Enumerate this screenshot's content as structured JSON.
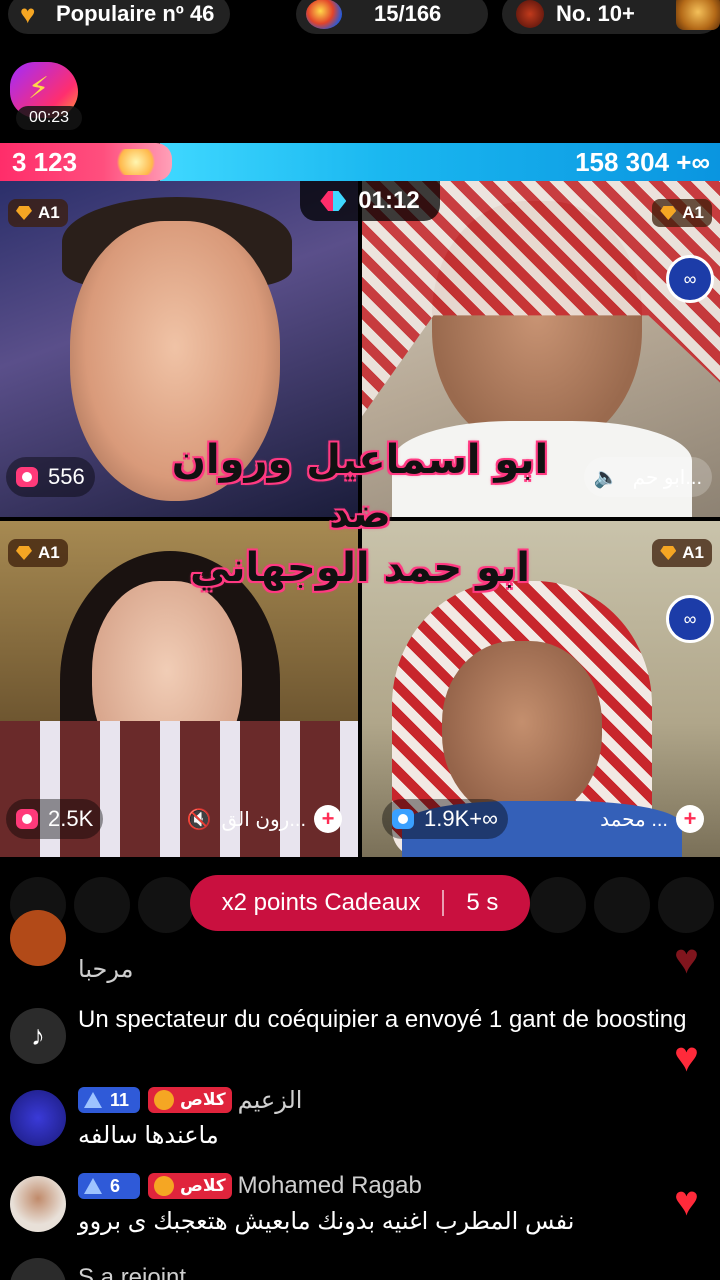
{
  "top_stats": {
    "popular": "Populaire nº 46",
    "progress": "15/166",
    "rank": "No. 10+"
  },
  "mini_badge": {
    "time": "00:23"
  },
  "score": {
    "left": "3 123",
    "right": "158 304",
    "left_fraction": 0.02
  },
  "battle": {
    "timer": "01:12",
    "overlay_title": [
      "ابو اسماعيل وروان",
      "ضد",
      "ابو حمد الوجهاني"
    ],
    "tiles": [
      {
        "tier": "A1",
        "stat": "556"
      },
      {
        "tier": "A1",
        "name": "ابو حم..."
      },
      {
        "tier": "A1",
        "stat": "2.5K",
        "name": "رون الق..."
      },
      {
        "tier": "A1",
        "stat": "1.9K+",
        "name": "محمد ..."
      }
    ]
  },
  "boost": {
    "label": "x2 points Cadeaux",
    "countdown": "5 s"
  },
  "chat": [
    {
      "text": "مرحبا"
    },
    {
      "text": "Un spectateur du coéquipier a envoyé 1 gant de boosting",
      "icon": "tiktok-icon"
    },
    {
      "username": "الزعيم",
      "level": "11",
      "fan_tag": "كلاص",
      "text": "ماعندها سالفه"
    },
    {
      "username": "Mohamed Ragab",
      "level": "6",
      "fan_tag": "كلاص",
      "text": "نفس المطرب اغنيه بدونك مابعيش هتعجبك ى بروو"
    },
    {
      "text": "S a rejoint"
    }
  ],
  "colors": {
    "team_left": "#ff2d6a",
    "team_right": "#1ab7f0",
    "boost": "#c9103f",
    "heart": "#ff2a3a"
  }
}
